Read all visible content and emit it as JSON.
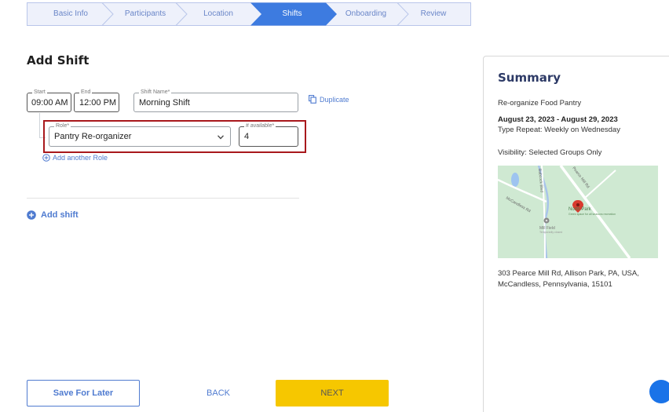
{
  "stepper": {
    "steps": [
      {
        "label": "Basic Info",
        "active": false
      },
      {
        "label": "Participants",
        "active": false
      },
      {
        "label": "Location",
        "active": false
      },
      {
        "label": "Shifts",
        "active": true
      },
      {
        "label": "Onboarding",
        "active": false
      },
      {
        "label": "Review",
        "active": false
      }
    ],
    "active_color": "#3d7be0",
    "inactive_color": "#eef1fb"
  },
  "page": {
    "title": "Add Shift"
  },
  "shift": {
    "start_label": "Start",
    "start_value": "09:00 AM",
    "end_label": "End",
    "end_value": "12:00 PM",
    "name_label": "Shift Name*",
    "name_value": "Morning Shift",
    "duplicate_label": "Duplicate"
  },
  "role": {
    "role_label": "Role*",
    "role_value": "Pantry Re-organizer",
    "available_label": "# available*",
    "available_value": "4",
    "add_role_label": "Add another Role"
  },
  "add_shift_label": "Add shift",
  "footer": {
    "save_later_label": "Save For Later",
    "back_label": "BACK",
    "next_label": "NEXT"
  },
  "summary": {
    "title": "Summary",
    "event_name": "Re-organize Food Pantry",
    "date_range": "August 23, 2023 - August 29, 2023",
    "repeat": "Type Repeat: Weekly on Wednesday",
    "visibility": "Visibility: Selected Groups Only",
    "address_line1": "303 Pearce Mill Rd, Allison Park, PA, USA,",
    "address_line2": "McCandless, Pennsylvania, 15101",
    "map": {
      "road_label_1": "Pearce Mill Rd",
      "road_label_2": "McCandless Rd",
      "road_label_3": "Babcock Blvd",
      "park_name": "North Park",
      "park_note": "Green space for all seasons recreation",
      "field_name": "Mill Field",
      "field_note": "Temporarily closed"
    }
  },
  "icons": {
    "duplicate": "copy-icon",
    "add_role": "plus-circle-icon",
    "add_shift": "plus-circle-filled-icon",
    "dropdown": "chevron-down-icon",
    "map_pin": "map-pin-icon",
    "chat": "chat-launcher-icon"
  }
}
